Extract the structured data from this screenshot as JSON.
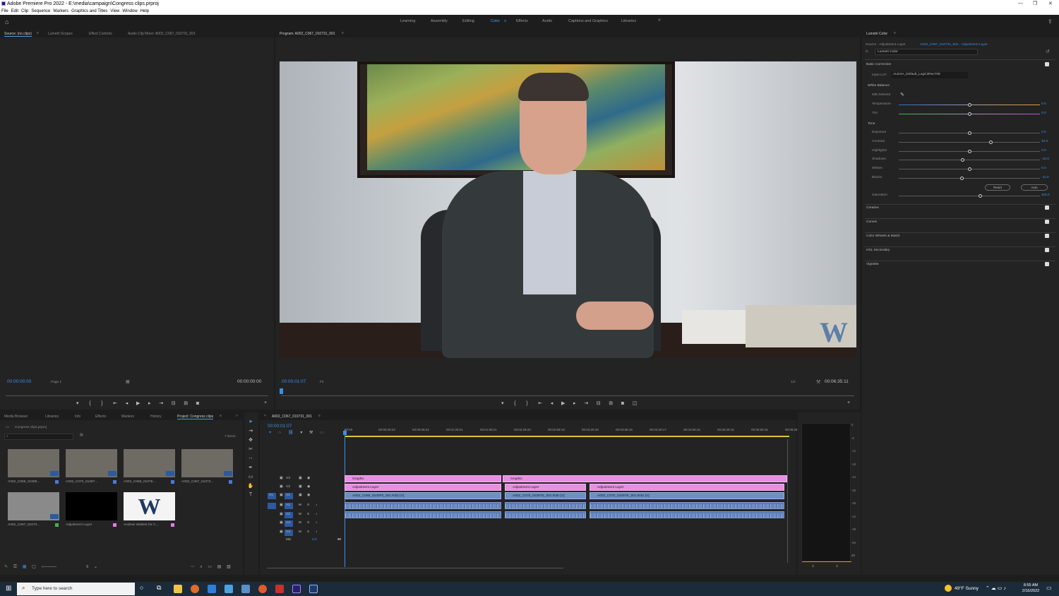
{
  "app": {
    "title": "Adobe Premiere Pro 2022 - E:\\media\\campaign\\Congress clips.prproj",
    "menu": [
      "File",
      "Edit",
      "Clip",
      "Sequence",
      "Markers",
      "Graphics and Titles",
      "View",
      "Window",
      "Help"
    ]
  },
  "workspaces": {
    "tabs": [
      "Learning",
      "Assembly",
      "Editing",
      "Color",
      "Effects",
      "Audio",
      "Captions and Graphics",
      "Libraries"
    ],
    "active": "Color",
    "more": "»"
  },
  "source_panel": {
    "tabs": [
      "Source: (no clips)",
      "Lumetri Scopes",
      "Effect Controls",
      "Audio Clip Mixer: A002_C067_010731_001"
    ],
    "timecode_left": "00:00:00:00",
    "page": "Page 1",
    "timecode_right": "00:00:00:00"
  },
  "program_panel": {
    "title": "Program: A002_C067_010731_001",
    "timecode": "00:00:01:07",
    "fit": "Fit",
    "resolution": "1/2",
    "duration": "00:06:35:11",
    "watermark_letter": "W"
  },
  "lumetri": {
    "panel_title": "Lumetri Color",
    "source_label": "Source · Adjustment Layer",
    "source_target": "A002_C067_010731_001 - Adjustment Layer",
    "effect_label": "Lumetri Color",
    "fx": "fx",
    "basic_correction": "Basic Correction",
    "input_lut_label": "Input LUT",
    "input_lut_value": "ALEXA_Default_LogC2Rec709",
    "white_balance": "White Balance",
    "wb_selector": "WB Selector",
    "sliders_wb": [
      {
        "label": "Temperature",
        "value": "0.0",
        "pos": 0.5
      },
      {
        "label": "Tint",
        "value": "0.0",
        "pos": 0.5
      }
    ],
    "tone": "Tone",
    "sliders_tone": [
      {
        "label": "Exposure",
        "value": "0.0",
        "pos": 0.5
      },
      {
        "label": "Contrast",
        "value": "30.0",
        "pos": 0.65
      },
      {
        "label": "Highlights",
        "value": "0.0",
        "pos": 0.5
      },
      {
        "label": "Shadows",
        "value": "-10.0",
        "pos": 0.45
      },
      {
        "label": "Whites",
        "value": "0.0",
        "pos": 0.5
      },
      {
        "label": "Blacks",
        "value": "-11.0",
        "pos": 0.445
      }
    ],
    "reset": "Reset",
    "auto": "Auto",
    "saturation": {
      "label": "Saturation",
      "value": "115.0",
      "pos": 0.575
    },
    "sections": [
      "Creative",
      "Curves",
      "Color Wheels & Match",
      "HSL Secondary",
      "Vignette"
    ]
  },
  "project_panel": {
    "tabs": [
      "Media Browser",
      "Libraries",
      "Info",
      "Effects",
      "Markers",
      "History",
      "Project: Congress clips"
    ],
    "project_file": "Congress clips.prproj",
    "items_count": "7 items",
    "items": [
      {
        "name": "A002_C069_01089...",
        "color": "#4a7ad8"
      },
      {
        "name": "A002_C070_01087...",
        "color": "#4a7ad8"
      },
      {
        "name": "A002_C068_0107E...",
        "color": "#4a7ad8"
      },
      {
        "name": "A002_C067_01073...",
        "color": "#4a7ad8"
      },
      {
        "name": "A002_C067_01073...",
        "color": "#3fb34f"
      },
      {
        "name": "Adjustment Layer",
        "color": "#e87ae0"
      },
      {
        "name": "Andrew Walters for C...",
        "color": "#e87ae0"
      }
    ]
  },
  "timeline": {
    "tab": "A002_C067_010731_001",
    "timecode": "00:00:01:07",
    "ruler": [
      "00:00",
      "00:00:29:23",
      "00:00:59:22",
      "00:01:29:21",
      "00:01:59:21",
      "00:02:29:20",
      "00:02:59:19",
      "00:03:29:18",
      "00:03:59:18",
      "00:04:29:17",
      "00:04:59:16",
      "00:05:29:16",
      "00:05:59:15",
      "00:06:29"
    ],
    "tracks": [
      "V3",
      "V2",
      "V1",
      "A1",
      "A2",
      "A3",
      "A4",
      "Mix"
    ],
    "mix_value": "0.0",
    "clips": {
      "graphic1": "Graphic",
      "graphic2": "Graphic",
      "adj1": "Adjustment Layer",
      "adj2": "Adjustment Layer",
      "adj3": "Adjustment Layer",
      "v1a": "A002_C069_0108F0_001.R3D [V]",
      "v1b": "A002_C070_0108TE_001.R3D [V]",
      "v1c": "A002_C070_0108TE_001.R3D [V]"
    }
  },
  "meter": {
    "ticks": [
      "0",
      "-6",
      "-12",
      "-18",
      "-24",
      "-30",
      "-36",
      "-42",
      "-48",
      "-54",
      "dB"
    ],
    "solo": [
      "S",
      "S"
    ]
  },
  "taskbar": {
    "search_placeholder": "Type here to search",
    "weather": "49°F  Sunny",
    "time": "8:55 AM",
    "date": "2/16/2022"
  }
}
